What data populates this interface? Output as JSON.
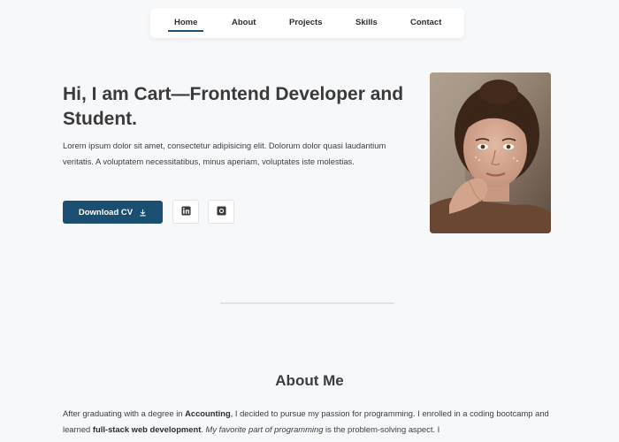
{
  "nav": {
    "items": [
      {
        "label": "Home",
        "active": true
      },
      {
        "label": "About"
      },
      {
        "label": "Projects"
      },
      {
        "label": "Skills"
      },
      {
        "label": "Contact"
      }
    ]
  },
  "hero": {
    "title": "Hi, I am Cart—Frontend Developer and Student.",
    "description": "Lorem ipsum dolor sit amet, consectetur adipisicing elit. Dolorum dolor quasi laudantium veritatis. A voluptatem necessitatibus, minus aperiam, voluptates iste molestias.",
    "download_button": "Download CV",
    "download_icon": "download-icon",
    "social": [
      {
        "icon": "linkedin-icon"
      },
      {
        "icon": "github-icon"
      }
    ]
  },
  "about": {
    "title": "About Me",
    "p1": "After graduating with a degree in ",
    "accounting": "Accounting",
    "p2": ", I decided to pursue my passion for programming. I enrolled in a coding bootcamp and learned ",
    "fullstack": "full-stack web development",
    "p3": ". ",
    "favorite": "My favorite part of programming",
    "p4": " is the problem-solving aspect. I"
  },
  "colors": {
    "accent": "#1a4f72",
    "background": "#f7f8fa"
  }
}
